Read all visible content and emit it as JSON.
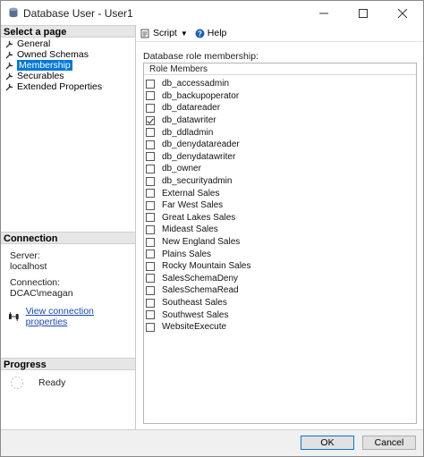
{
  "window": {
    "title": "Database User - User1"
  },
  "left_panel": {
    "select_page_header": "Select a page",
    "pages": [
      {
        "label": "General",
        "selected": false
      },
      {
        "label": "Owned Schemas",
        "selected": false
      },
      {
        "label": "Membership",
        "selected": true
      },
      {
        "label": "Securables",
        "selected": false
      },
      {
        "label": "Extended Properties",
        "selected": false
      }
    ],
    "connection": {
      "header": "Connection",
      "server_label": "Server:",
      "server_value": "localhost",
      "connection_label": "Connection:",
      "connection_value": "DCAC\\meagan",
      "view_link": "View connection properties"
    },
    "progress": {
      "header": "Progress",
      "status": "Ready"
    }
  },
  "toolbar": {
    "script_label": "Script",
    "help_label": "Help"
  },
  "membership": {
    "section_label": "Database role membership:",
    "column_header": "Role Members",
    "roles": [
      {
        "name": "db_accessadmin",
        "checked": false
      },
      {
        "name": "db_backupoperator",
        "checked": false
      },
      {
        "name": "db_datareader",
        "checked": false
      },
      {
        "name": "db_datawriter",
        "checked": true
      },
      {
        "name": "db_ddladmin",
        "checked": false
      },
      {
        "name": "db_denydatareader",
        "checked": false
      },
      {
        "name": "db_denydatawriter",
        "checked": false
      },
      {
        "name": "db_owner",
        "checked": false
      },
      {
        "name": "db_securityadmin",
        "checked": false
      },
      {
        "name": "External Sales",
        "checked": false
      },
      {
        "name": "Far West Sales",
        "checked": false
      },
      {
        "name": "Great Lakes Sales",
        "checked": false
      },
      {
        "name": "Mideast Sales",
        "checked": false
      },
      {
        "name": "New England Sales",
        "checked": false
      },
      {
        "name": "Plains Sales",
        "checked": false
      },
      {
        "name": "Rocky Mountain Sales",
        "checked": false
      },
      {
        "name": "SalesSchemaDeny",
        "checked": false
      },
      {
        "name": "SalesSchemaRead",
        "checked": false
      },
      {
        "name": "Southeast Sales",
        "checked": false
      },
      {
        "name": "Southwest Sales",
        "checked": false
      },
      {
        "name": "WebsiteExecute",
        "checked": false
      }
    ]
  },
  "footer": {
    "ok_label": "OK",
    "cancel_label": "Cancel"
  }
}
